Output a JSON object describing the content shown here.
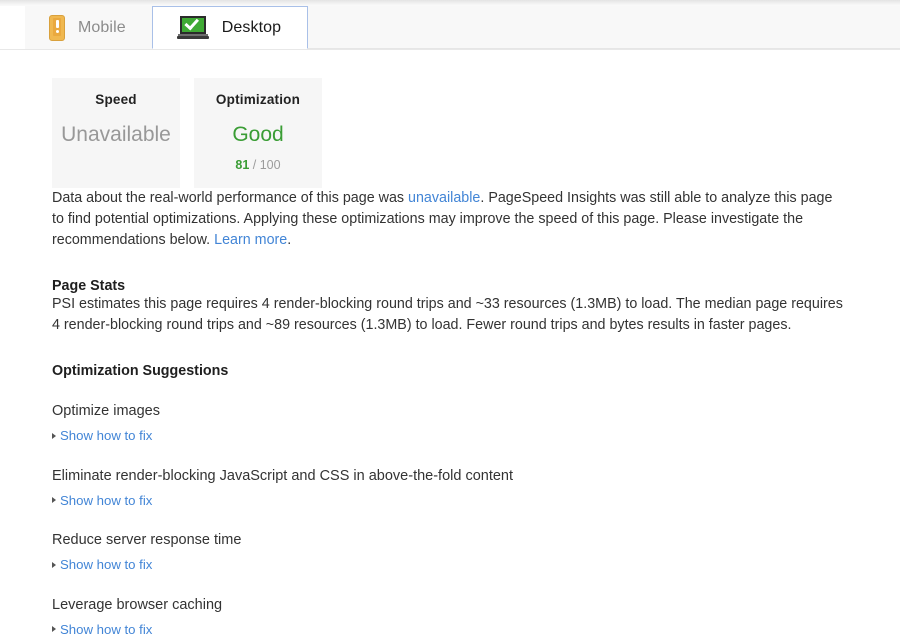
{
  "tabs": [
    {
      "label": "Mobile",
      "icon": "mobile-phone-warning-icon",
      "active": false
    },
    {
      "label": "Desktop",
      "icon": "laptop-check-icon",
      "active": true
    }
  ],
  "cards": [
    {
      "title": "Speed",
      "value": "Unavailable",
      "score": "",
      "score_total": ""
    },
    {
      "title": "Optimization",
      "value": "Good",
      "score": "81",
      "score_total": "/ 100"
    }
  ],
  "intro": {
    "part1": "Data about the real-world performance of this page was ",
    "link1": "unavailable",
    "part2": ". PageSpeed Insights was still able to analyze this page to find potential optimizations. Applying these optimizations may improve the speed of this page. Please investigate the recommendations below. ",
    "link2": "Learn more",
    "part3": "."
  },
  "page_stats": {
    "heading": "Page Stats",
    "text": "PSI estimates this page requires 4 render-blocking round trips and ~33 resources (1.3MB) to load. The median page requires 4 render-blocking round trips and ~89 resources (1.3MB) to load. Fewer round trips and bytes results in faster pages."
  },
  "optimization": {
    "heading": "Optimization Suggestions",
    "show_fix_label": "Show how to fix",
    "items": [
      {
        "title": "Optimize images"
      },
      {
        "title": "Eliminate render-blocking JavaScript and CSS in above-the-fold content"
      },
      {
        "title": "Reduce server response time"
      },
      {
        "title": "Leverage browser caching"
      }
    ]
  },
  "colors": {
    "accent_link": "#4285d6",
    "good_green": "#3a9d35",
    "muted_gray": "#989898",
    "tab_active_border": "#a9c0e8",
    "card_background": "#f6f6f6"
  }
}
